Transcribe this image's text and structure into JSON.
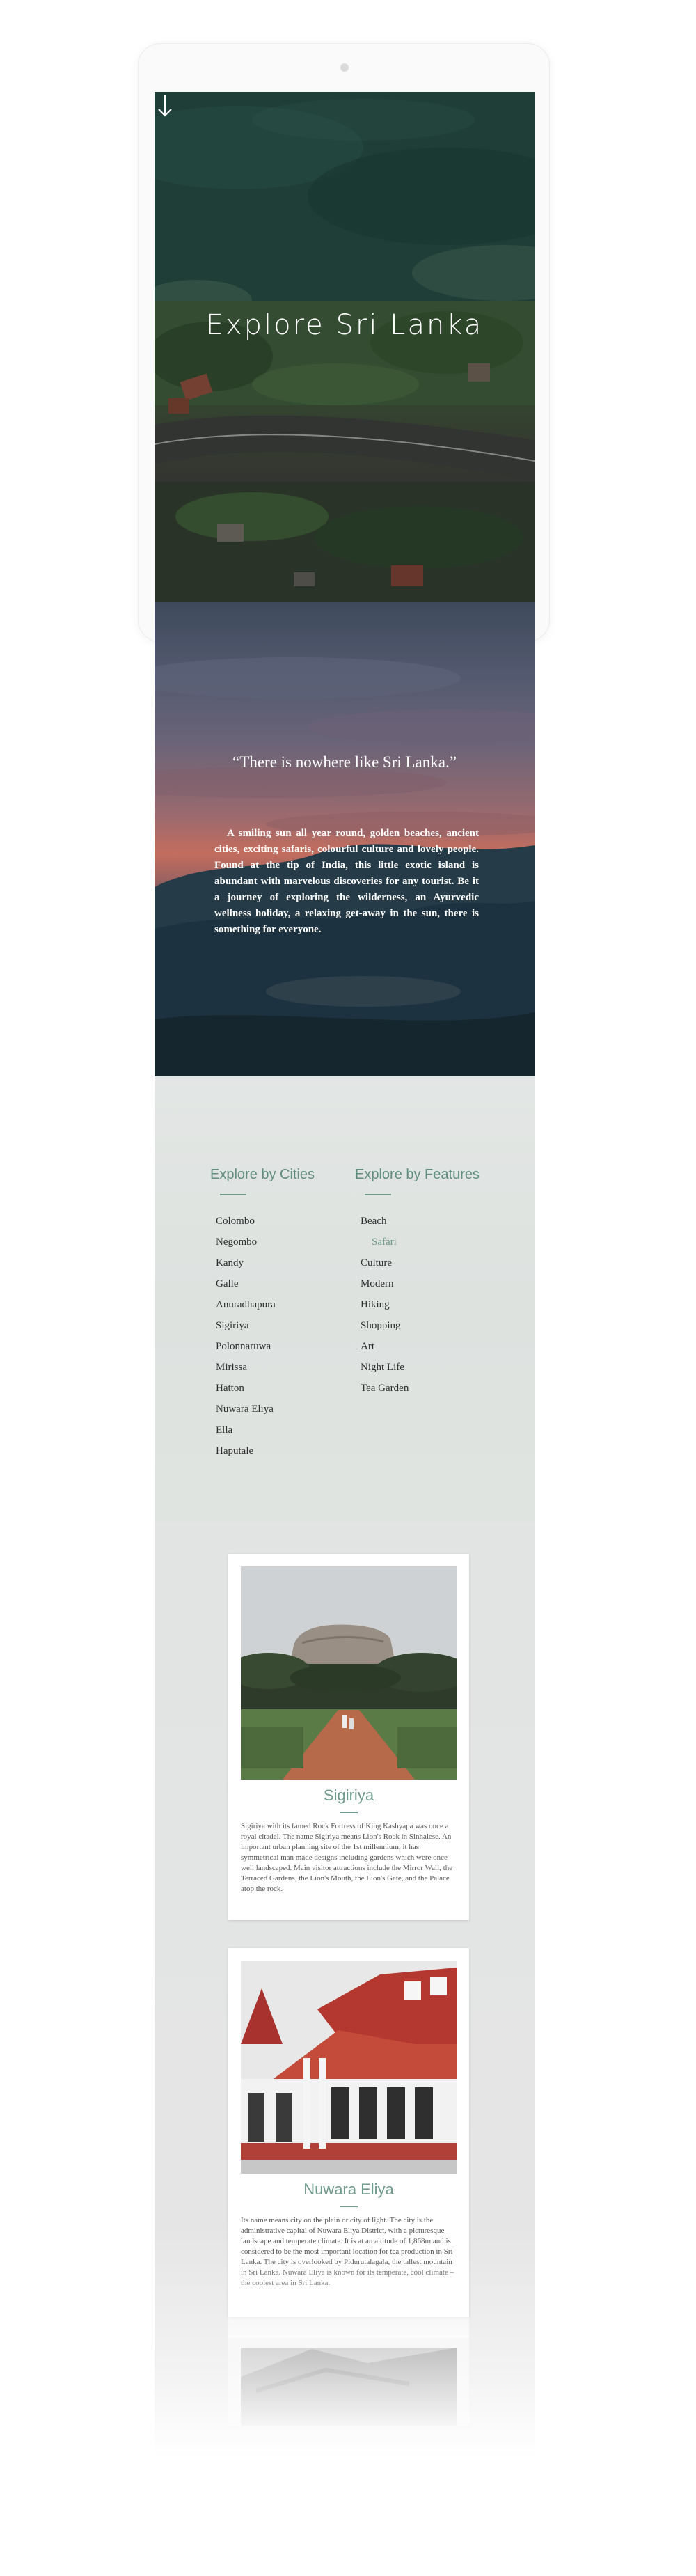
{
  "hero": {
    "title": "Explore Sri Lanka"
  },
  "quote": {
    "title": "“There is nowhere like Sri Lanka.”",
    "body": "A smiling sun all year round, golden beaches, ancient cities, exciting safaris, colourful culture and lovely people. Found at the tip of India, this little exotic island is abundant with marvelous discoveries for any tourist. Be it a journey of exploring the wilderness, an Ayurvedic wellness holiday, a relaxing get-away in the sun, there is something for everyone."
  },
  "explore": {
    "cities": {
      "title": "Explore by Cities",
      "items": [
        "Colombo",
        "Negombo",
        "Kandy",
        "Galle",
        "Anuradhapura",
        "Sigiriya",
        "Polonnaruwa",
        "Mirissa",
        "Hatton",
        "Nuwara Eliya",
        "Ella",
        "Haputale"
      ]
    },
    "features": {
      "title": "Explore by Features",
      "items": [
        "Beach",
        "Safari",
        "Culture",
        "Modern",
        "Hiking",
        "Shopping",
        "Art",
        "Night Life",
        "Tea Garden"
      ],
      "active_item": "Safari"
    }
  },
  "cards": [
    {
      "title": "Sigiriya",
      "text": "Sigiriya with its famed Rock Fortress of King Kashyapa was once a royal citadel. The name Sigiriya means Lion's Rock in Sinhalese. An important urban planning site of the 1st millennium, it has symmetrical man made designs including gardens which were once well landscaped. Main visitor attractions include the Mirror Wall, the Terraced Gardens, the Lion's Mouth, the Lion's Gate, and the Palace atop the rock."
    },
    {
      "title": "Nuwara Eliya",
      "text": "Its name means city on the plain or city of light. The city is the administrative capital of Nuwara Eliya District, with a picturesque landscape and temperate climate. It is at an altitude of 1,868m and is considered to be the most important location for tea production in Sri Lanka. The city is overlooked by Pidurutalagala, the tallest mountain in Sri Lanka. Nuwara Eliya is known for its temperate, cool climate – the coolest area in Sri Lanka."
    }
  ],
  "colors": {
    "accent": "#6f9a8c",
    "explore_bg": "#e0e4e1"
  },
  "icons": {
    "hero_arrow": "arrow-down-icon"
  }
}
